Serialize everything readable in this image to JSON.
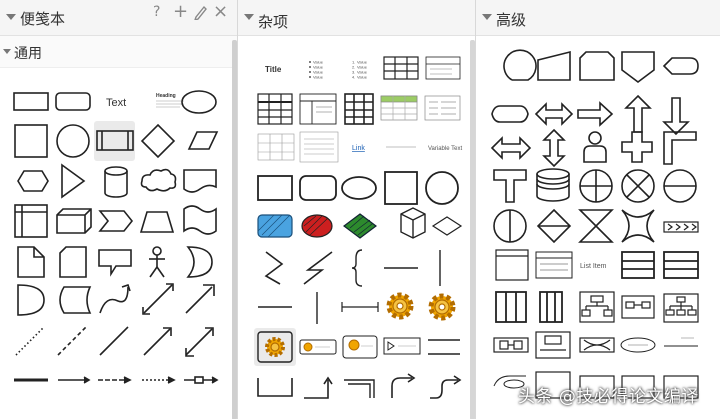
{
  "panels": {
    "left": {
      "title": "便笺本",
      "section": "通用"
    },
    "middle": {
      "title": "杂项"
    },
    "right": {
      "title": "高级"
    }
  },
  "toolbar": {
    "help": "?",
    "add": "+",
    "edit": "edit",
    "close": "×"
  },
  "shape_labels": {
    "text": "Text",
    "heading": "Heading",
    "title": "Title",
    "link": "Link",
    "variable_text": "Variable Text",
    "list_item": "List Item",
    "value": "Value"
  },
  "watermark": "头条 @技必得论文编译",
  "colors": {
    "header_bg": "#f5f5f5",
    "stroke": "#222222",
    "selected": "#eaeaea",
    "blue": "#4aa3e0",
    "red": "#cc1f1f",
    "green": "#2d8a2d",
    "gear": "#f0a500"
  },
  "icons": [
    "help-icon",
    "add-icon",
    "edit-icon",
    "close-icon",
    "collapse-triangle-icon"
  ]
}
